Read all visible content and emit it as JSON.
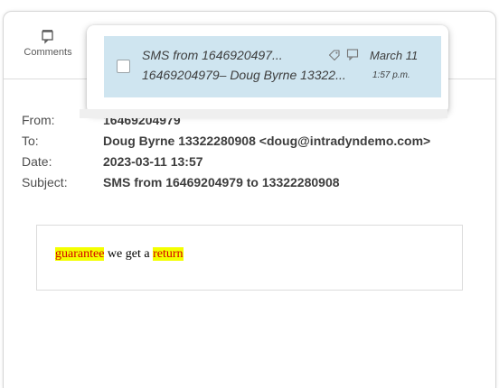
{
  "toolbar": {
    "comments_label": "Comments"
  },
  "popup_item": {
    "line1": "SMS from 1646920497...",
    "line2": "16469204979– Doug Byrne 13322...",
    "date": "March 11",
    "time": "1:57 p.m."
  },
  "email": {
    "from_label": "From:",
    "from_value": "16469204979",
    "to_label": "To:",
    "to_value": "Doug Byrne 13322280908 <doug@intradyndemo.com>",
    "date_label": "Date:",
    "date_value": "2023-03-11 13:57",
    "subject_label": "Subject:",
    "subject_value": "SMS from 16469204979 to 13322280908"
  },
  "body": {
    "word1": "guarantee",
    "middle": " we get a ",
    "word2": "return"
  },
  "colors": {
    "highlight_bg": "#f4ff00",
    "highlight_text": "#d40000",
    "selected_item_bg": "#cfe5f0"
  }
}
